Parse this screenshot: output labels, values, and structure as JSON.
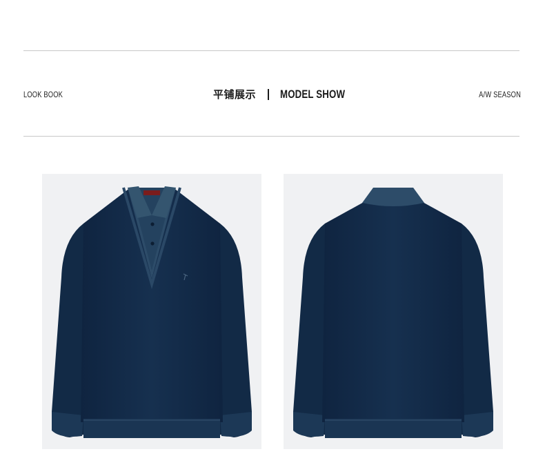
{
  "header": {
    "left_label": "LOOK BOOK",
    "title_cn": "平铺展示",
    "separator": "|",
    "title_en": "MODEL SHOW",
    "right_label": "A/W SEASON"
  },
  "gallery": {
    "items": [
      {
        "name": "front-view",
        "garment_color": "#122a45",
        "collar_color": "#2b4a66"
      },
      {
        "name": "back-view",
        "garment_color": "#122a45",
        "collar_color": "#2b4a66"
      }
    ]
  }
}
